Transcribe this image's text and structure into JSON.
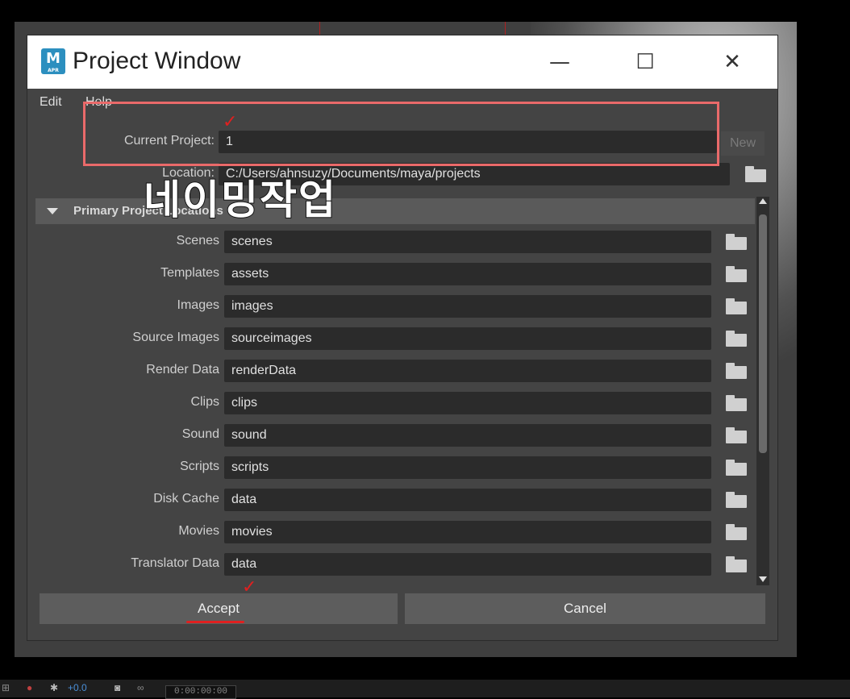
{
  "window": {
    "title": "Project Window",
    "icon_letter": "M",
    "icon_sub": "APR",
    "minimize_glyph": "—",
    "maximize_glyph": "☐",
    "close_glyph": "✕"
  },
  "menu": [
    "Edit",
    "Help"
  ],
  "current_project": {
    "label": "Current Project:",
    "value": "1",
    "new_button": "New"
  },
  "location": {
    "label": "Location:",
    "value": "C:/Users/ahnsuzy/Documents/maya/projects"
  },
  "section": {
    "title": "Primary Project Locations"
  },
  "locations": [
    {
      "label": "Scenes",
      "value": "scenes"
    },
    {
      "label": "Templates",
      "value": "assets"
    },
    {
      "label": "Images",
      "value": "images"
    },
    {
      "label": "Source Images",
      "value": "sourceimages"
    },
    {
      "label": "Render Data",
      "value": "renderData"
    },
    {
      "label": "Clips",
      "value": "clips"
    },
    {
      "label": "Sound",
      "value": "sound"
    },
    {
      "label": "Scripts",
      "value": "scripts"
    },
    {
      "label": "Disk Cache",
      "value": "data"
    },
    {
      "label": "Movies",
      "value": "movies"
    },
    {
      "label": "Translator Data",
      "value": "data"
    }
  ],
  "buttons": {
    "accept": "Accept",
    "cancel": "Cancel"
  },
  "annotations": {
    "overlay_text": "네이밍작업",
    "checkmark": "✓"
  },
  "taskbar": {
    "offset": "+0.0",
    "timecode": "0:00:00:00"
  },
  "colors": {
    "annotation_red": "#ea6a6a",
    "icon_blue": "#2c8fbf"
  }
}
